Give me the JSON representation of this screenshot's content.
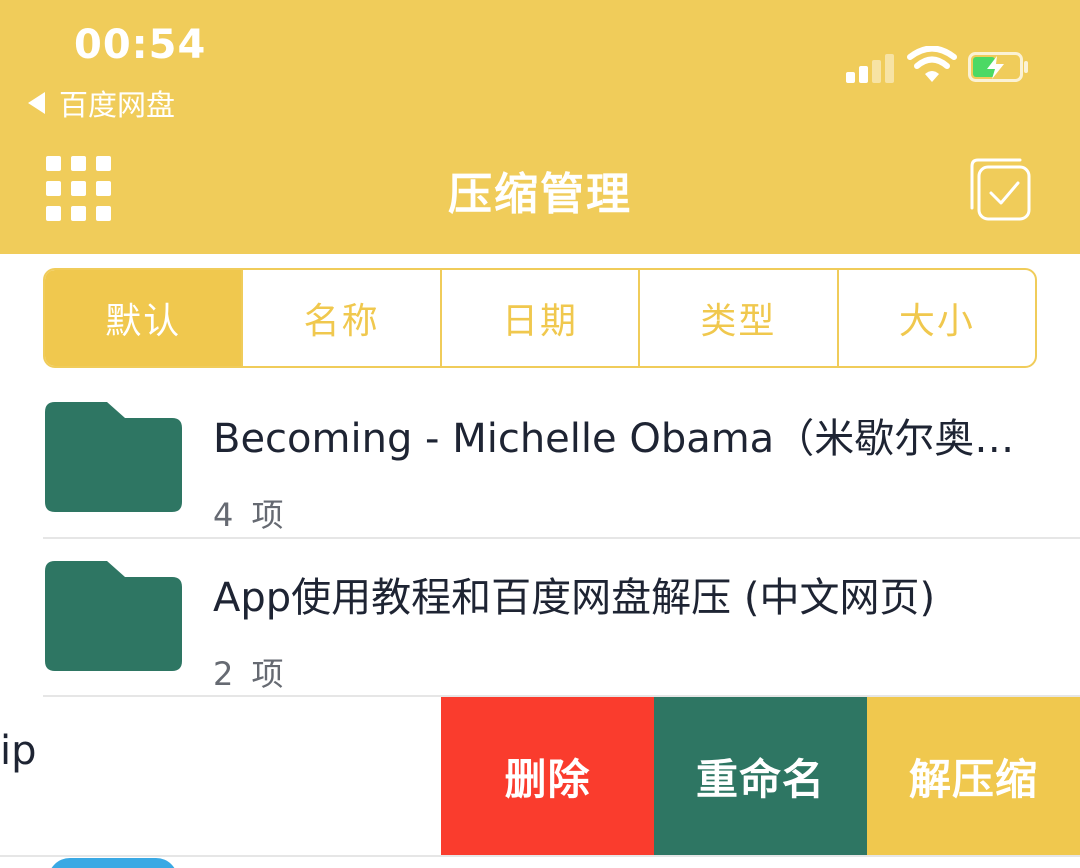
{
  "status_bar": {
    "time": "00:54",
    "back_app": "百度网盘",
    "icons": [
      "cellular-signal-icon",
      "wifi-icon",
      "battery-charging-icon"
    ]
  },
  "nav": {
    "title": "压缩管理",
    "left_icon": "grid-menu-icon",
    "right_icon": "multi-select-icon"
  },
  "sort_tabs": {
    "items": [
      "默认",
      "名称",
      "日期",
      "类型",
      "大小"
    ],
    "active": "默认"
  },
  "files": [
    {
      "name": "Becoming - Michelle Obama（米歇尔奥…",
      "count": "4 项",
      "icon": "folder-icon"
    },
    {
      "name": "App使用教程和百度网盘解压 (中文网页)",
      "count": "2 项",
      "icon": "folder-icon"
    }
  ],
  "swiped_item": {
    "partial_name": "ip",
    "actions": {
      "delete": "删除",
      "rename": "重命名",
      "unzip": "解压缩"
    }
  },
  "colors": {
    "header": "#f0cc5a",
    "accent": "#f0c84e",
    "folder": "#2e7663",
    "delete": "#fa3c2d",
    "rename": "#2e7663",
    "unzip": "#f0c84e"
  }
}
